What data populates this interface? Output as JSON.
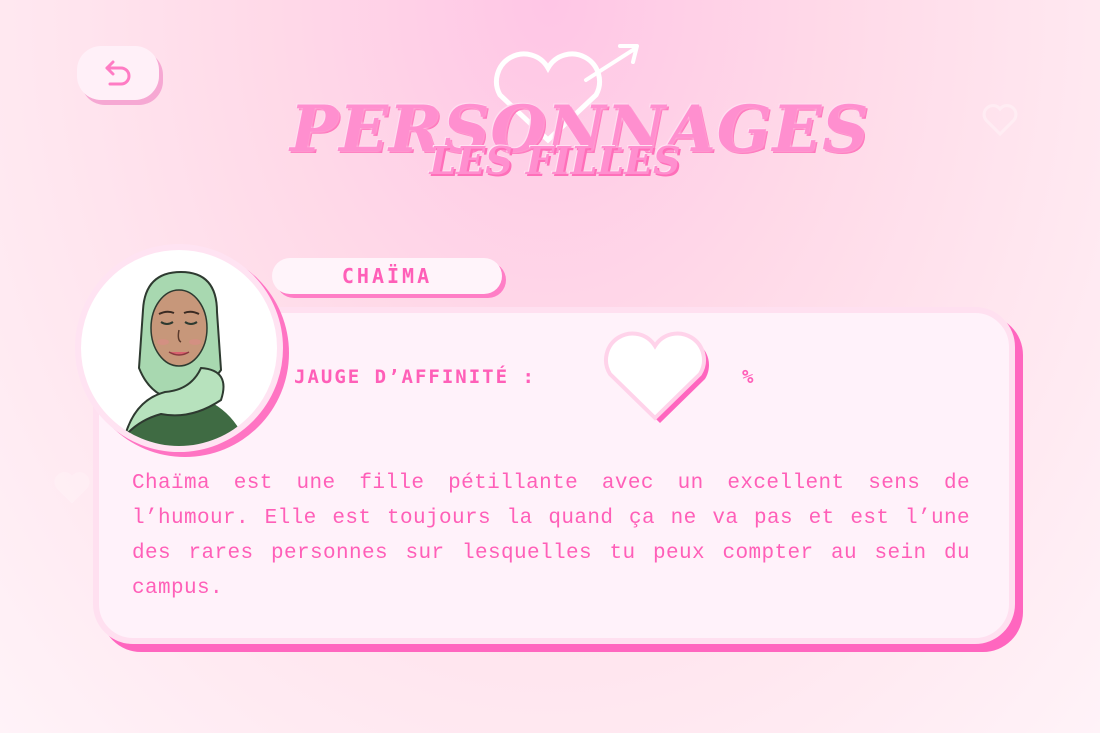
{
  "header": {
    "title": "PERSONNAGES",
    "subtitle": "LES FILLES",
    "back_icon": "back-arrow-icon",
    "title_icon": "heart-arrow-icon"
  },
  "character": {
    "name": "CHAÏMA",
    "avatar_icon": "character-portrait",
    "affinity_label": "JAUGE D’AFFINITÉ :",
    "affinity_icon": "heart-gauge-icon",
    "affinity_level": 0,
    "affinity_suffix": "%",
    "description": "Chaïma est une fille pétillante avec un excellent sens de l’humour. Elle est toujours la quand ça ne va pas et est l’une des rares personnes sur lesquelles tu peux compter au sein du campus."
  },
  "colors": {
    "accent": "#ff5fb8",
    "card_shadow": "#ff66bf",
    "card_bg": "#fff2fa",
    "hijab": "#a8d8b0",
    "skin": "#c7977a"
  }
}
